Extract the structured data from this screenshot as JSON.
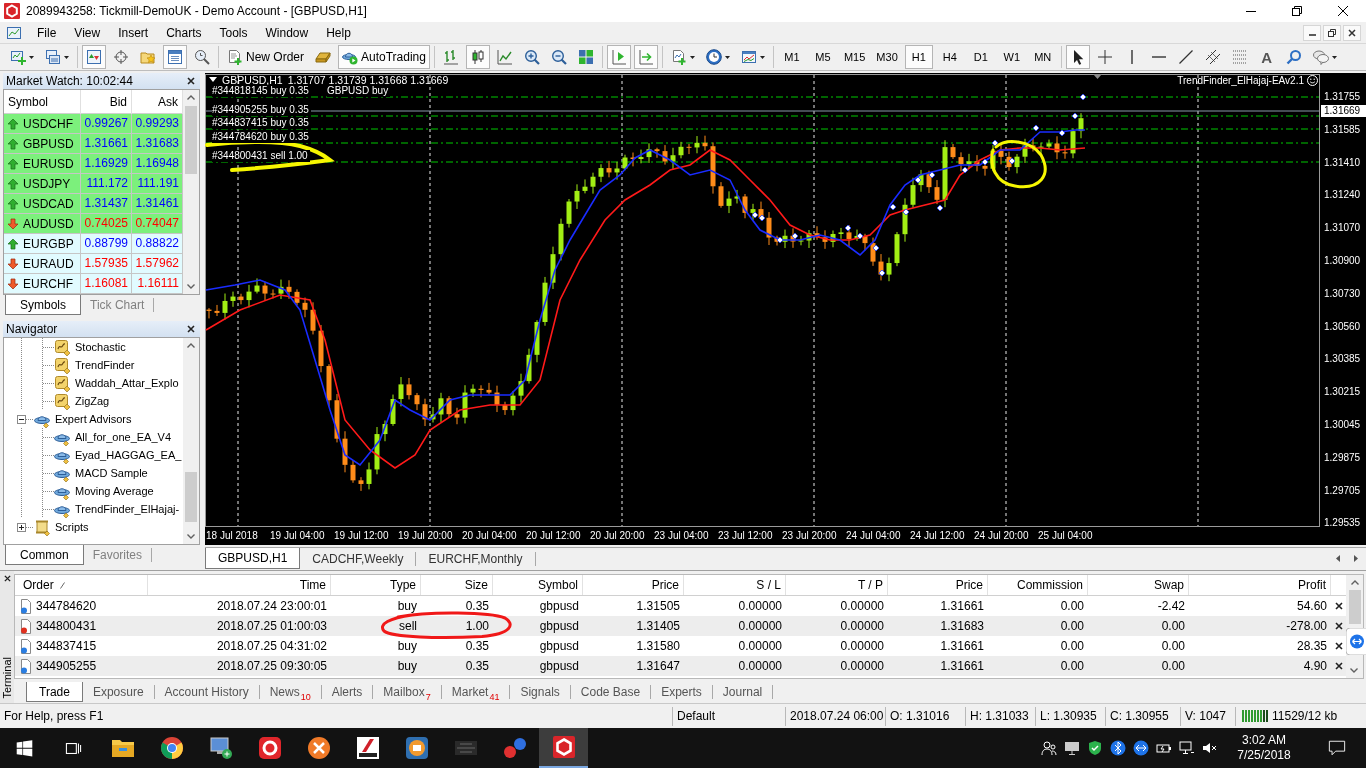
{
  "window": {
    "title": "2089943258: Tickmill-DemoUK - Demo Account - [GBPUSD,H1]"
  },
  "menu": [
    "File",
    "View",
    "Insert",
    "Charts",
    "Tools",
    "Window",
    "Help"
  ],
  "toolbar": [
    [
      {
        "kind": "new-chart",
        "pressed": false,
        "caret": true
      },
      {
        "kind": "profiles",
        "pressed": false,
        "caret": true
      }
    ],
    [
      {
        "kind": "market-watch",
        "pressed": true
      },
      {
        "kind": "data-window",
        "pressed": false
      },
      {
        "kind": "navigator",
        "pressed": false
      },
      {
        "kind": "terminal",
        "pressed": true
      },
      {
        "kind": "tester",
        "pressed": false
      }
    ],
    [
      {
        "kind": "new-order",
        "label": "New Order",
        "pressed": false
      },
      {
        "kind": "editor",
        "pressed": false
      },
      {
        "kind": "auto-trading",
        "label": "AutoTrading",
        "pressed": true
      }
    ],
    [
      {
        "kind": "bar-chart",
        "pressed": false
      },
      {
        "kind": "candles",
        "pressed": true
      },
      {
        "kind": "line-chart",
        "pressed": false
      },
      {
        "kind": "zoom-in",
        "pressed": false
      },
      {
        "kind": "zoom-out",
        "pressed": false
      },
      {
        "kind": "tile",
        "pressed": false
      }
    ],
    [
      {
        "kind": "chart-shift",
        "pressed": true
      },
      {
        "kind": "autoscroll",
        "pressed": true
      }
    ],
    [
      {
        "kind": "indicators",
        "pressed": false,
        "caret": true
      },
      {
        "kind": "periods",
        "pressed": false,
        "caret": true
      },
      {
        "kind": "templates",
        "pressed": false,
        "caret": true
      }
    ],
    [
      {
        "kind": "period",
        "label": "M1",
        "selected": false
      },
      {
        "kind": "period",
        "label": "M5",
        "selected": false
      },
      {
        "kind": "period",
        "label": "M15",
        "selected": false
      },
      {
        "kind": "period",
        "label": "M30",
        "selected": false
      },
      {
        "kind": "period",
        "label": "H1",
        "selected": true
      },
      {
        "kind": "period",
        "label": "H4",
        "selected": false
      },
      {
        "kind": "period",
        "label": "D1",
        "selected": false
      },
      {
        "kind": "period",
        "label": "W1",
        "selected": false
      },
      {
        "kind": "period",
        "label": "MN",
        "selected": false
      }
    ],
    [
      {
        "kind": "cursor",
        "pressed": true
      },
      {
        "kind": "crosshair",
        "pressed": false
      },
      {
        "kind": "vline",
        "pressed": false
      },
      {
        "kind": "hline",
        "pressed": false
      },
      {
        "kind": "trendline",
        "pressed": false
      },
      {
        "kind": "channel",
        "pressed": false
      },
      {
        "kind": "fibo",
        "pressed": false
      },
      {
        "kind": "text",
        "label": "A",
        "pressed": false
      },
      {
        "kind": "search",
        "pressed": false
      },
      {
        "kind": "chat",
        "pressed": false,
        "caret": true
      }
    ]
  ],
  "market_watch": {
    "title": "Market Watch: 10:02:44",
    "columns": [
      "Symbol",
      "Bid",
      "Ask"
    ],
    "rows": [
      {
        "symbol": "USDCHF",
        "bid": "0.99267",
        "ask": "0.99293",
        "kind": "up",
        "highlighted": true
      },
      {
        "symbol": "GBPUSD",
        "bid": "1.31661",
        "ask": "1.31683",
        "kind": "up",
        "highlighted": true
      },
      {
        "symbol": "EURUSD",
        "bid": "1.16929",
        "ask": "1.16948",
        "kind": "up",
        "highlighted": true
      },
      {
        "symbol": "USDJPY",
        "bid": "111.172",
        "ask": "111.191",
        "kind": "up",
        "highlighted": true
      },
      {
        "symbol": "USDCAD",
        "bid": "1.31437",
        "ask": "1.31461",
        "kind": "up",
        "highlighted": true
      },
      {
        "symbol": "AUDUSD",
        "bid": "0.74025",
        "ask": "0.74047",
        "kind": "down",
        "highlighted": true
      },
      {
        "symbol": "EURGBP",
        "bid": "0.88799",
        "ask": "0.88822",
        "kind": "up",
        "highlighted": false
      },
      {
        "symbol": "EURAUD",
        "bid": "1.57935",
        "ask": "1.57962",
        "kind": "down",
        "highlighted": false
      },
      {
        "symbol": "EURCHF",
        "bid": "1.16081",
        "ask": "1.16111",
        "kind": "down",
        "highlighted": false
      }
    ],
    "tabs": [
      {
        "label": "Symbols",
        "selected": true
      },
      {
        "label": "Tick Chart",
        "selected": false
      }
    ]
  },
  "navigator": {
    "title": "Navigator",
    "tree": [
      {
        "children": [
          {
            "label": "Stochastic",
            "kind": "indicator"
          },
          {
            "label": "TrendFinder",
            "kind": "indicator"
          },
          {
            "label": "Waddah_Attar_Explo",
            "kind": "indicator"
          },
          {
            "label": "ZigZag",
            "kind": "indicator"
          }
        ]
      },
      {
        "label": "Expert Advisors",
        "kind": "expert",
        "expanded": true,
        "children": [
          {
            "label": "All_for_one_EA_V4",
            "kind": "expert"
          },
          {
            "label": "Eyad_HAGGAG_EA_",
            "kind": "expert"
          },
          {
            "label": "MACD Sample",
            "kind": "expert"
          },
          {
            "label": "Moving Average",
            "kind": "expert"
          },
          {
            "label": "TrendFinder_ElHajaj-",
            "kind": "expert"
          }
        ]
      },
      {
        "label": "Scripts",
        "kind": "script",
        "expanded": false
      }
    ],
    "tabs": [
      {
        "label": "Common",
        "selected": true
      },
      {
        "label": "Favorites",
        "selected": false
      }
    ]
  },
  "chart": {
    "symbol": "GBPUSD,H1",
    "ohlc": "1.31707 1.31739 1.31668 1.31669",
    "expert": "TrendFinder_ElHajaj-EAv2.1",
    "order_lines": [
      {
        "label": "#344818145 buy 0.35"
      },
      {
        "label": "#344905255 buy 0.35"
      },
      {
        "label": "#344837415 buy 0.35"
      },
      {
        "label": "#344784620 buy 0.35"
      },
      {
        "label": "#344800431 sell 1.00"
      }
    ],
    "order_note": "GBPUSD buy",
    "bid": "1.31669",
    "price_axis": [
      "1.31755",
      "1.31585",
      "1.31410",
      "1.31240",
      "1.31070",
      "1.30900",
      "1.30730",
      "1.30560",
      "1.30385",
      "1.30215",
      "1.30045",
      "1.29875",
      "1.29705",
      "1.29535"
    ],
    "time_axis": [
      "18 Jul 2018",
      "19 Jul 04:00",
      "19 Jul 12:00",
      "19 Jul 20:00",
      "20 Jul 04:00",
      "20 Jul 12:00",
      "20 Jul 20:00",
      "23 Jul 04:00",
      "23 Jul 12:00",
      "23 Jul 20:00",
      "24 Jul 04:00",
      "24 Jul 12:00",
      "24 Jul 20:00",
      "25 Jul 04:00"
    ]
  },
  "chart_tabs": [
    {
      "label": "GBPUSD,H1",
      "selected": true
    },
    {
      "label": "CADCHF,Weekly",
      "selected": false
    },
    {
      "label": "EURCHF,Monthly",
      "selected": false
    }
  ],
  "terminal": {
    "label": "Terminal",
    "columns": [
      {
        "label": "Order",
        "sorted": true
      },
      {
        "label": "Time",
        "sorted": false
      },
      {
        "label": "Type",
        "sorted": false
      },
      {
        "label": "Size",
        "sorted": false
      },
      {
        "label": "Symbol",
        "sorted": false
      },
      {
        "label": "Price",
        "sorted": false
      },
      {
        "label": "S / L",
        "sorted": false
      },
      {
        "label": "T / P",
        "sorted": false
      },
      {
        "label": "Price",
        "sorted": false
      },
      {
        "label": "Commission",
        "sorted": false
      },
      {
        "label": "Swap",
        "sorted": false
      },
      {
        "label": "Profit",
        "sorted": false
      }
    ],
    "rows": [
      {
        "kind": "buy",
        "cells": [
          "344784620",
          "2018.07.24 23:00:01",
          "buy",
          "0.35",
          "gbpusd",
          "1.31505",
          "0.00000",
          "0.00000",
          "1.31661",
          "0.00",
          "-2.42",
          "54.60"
        ]
      },
      {
        "kind": "sell",
        "cells": [
          "344800431",
          "2018.07.25 01:00:03",
          "sell",
          "1.00",
          "gbpusd",
          "1.31405",
          "0.00000",
          "0.00000",
          "1.31683",
          "0.00",
          "0.00",
          "-278.00"
        ]
      },
      {
        "kind": "buy",
        "cells": [
          "344837415",
          "2018.07.25 04:31:02",
          "buy",
          "0.35",
          "gbpusd",
          "1.31580",
          "0.00000",
          "0.00000",
          "1.31661",
          "0.00",
          "0.00",
          "28.35"
        ]
      },
      {
        "kind": "buy",
        "cells": [
          "344905255",
          "2018.07.25 09:30:05",
          "buy",
          "0.35",
          "gbpusd",
          "1.31647",
          "0.00000",
          "0.00000",
          "1.31661",
          "0.00",
          "0.00",
          "4.90"
        ]
      }
    ],
    "tabs": [
      {
        "label": "Trade",
        "selected": true
      },
      {
        "label": "Exposure",
        "selected": false
      },
      {
        "label": "Account History",
        "selected": false
      },
      {
        "label": "News",
        "count": "10",
        "selected": false
      },
      {
        "label": "Alerts",
        "selected": false
      },
      {
        "label": "Mailbox",
        "count": "7",
        "selected": false
      },
      {
        "label": "Market",
        "count": "41",
        "selected": false
      },
      {
        "label": "Signals",
        "selected": false
      },
      {
        "label": "Code Base",
        "selected": false
      },
      {
        "label": "Experts",
        "selected": false
      },
      {
        "label": "Journal",
        "selected": false
      }
    ]
  },
  "status_bar": {
    "help": "For Help, press F1",
    "profile": "Default",
    "fields": [
      "2018.07.24 06:00",
      "O: 1.31016",
      "H: 1.31033",
      "L: 1.30935",
      "C: 1.30955",
      "V: 1047"
    ],
    "traffic": "11529/12 kb"
  },
  "taskbar": {
    "apps": [
      {
        "kind": "start",
        "active": false
      },
      {
        "kind": "task-view",
        "active": false
      },
      {
        "kind": "explorer",
        "active": false
      },
      {
        "kind": "browser",
        "active": false
      },
      {
        "kind": "computer",
        "active": false
      },
      {
        "kind": "ring-tile",
        "active": false
      },
      {
        "kind": "circle-cross",
        "active": false
      },
      {
        "kind": "slash-tile",
        "active": false
      },
      {
        "kind": "square-ring",
        "active": false
      },
      {
        "kind": "emblem",
        "active": false
      },
      {
        "kind": "dots",
        "active": false
      },
      {
        "kind": "trader",
        "active": true
      }
    ],
    "tray": [
      {
        "kind": "people"
      },
      {
        "kind": "monitor"
      },
      {
        "kind": "shield"
      },
      {
        "kind": "bluetooth"
      },
      {
        "kind": "remote"
      },
      {
        "kind": "battery"
      },
      {
        "kind": "network"
      },
      {
        "kind": "mute"
      }
    ],
    "time": "3:02 AM",
    "date": "7/25/2018"
  }
}
